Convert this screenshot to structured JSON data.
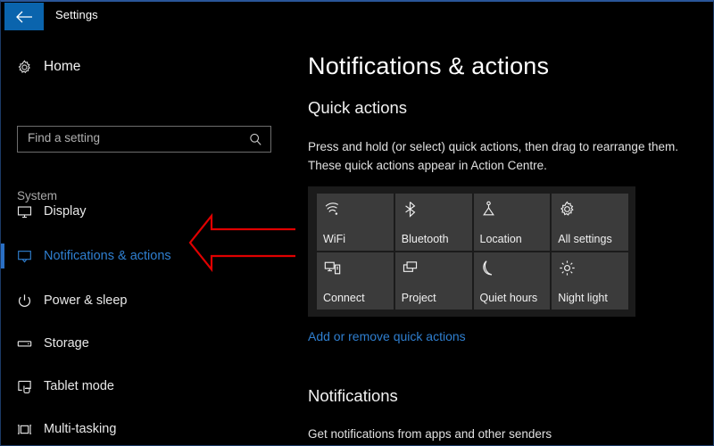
{
  "window": {
    "title": "Settings",
    "back_icon": "back-arrow-icon",
    "accent_color": "#0a64ad",
    "background_color": "#000000"
  },
  "sidebar": {
    "home": {
      "label": "Home",
      "icon": "gear-icon"
    },
    "search": {
      "value": "",
      "placeholder": "Find a setting",
      "icon": "search-icon"
    },
    "section_header": "System",
    "items": [
      {
        "label": "Display",
        "icon": "monitor-icon",
        "selected": false
      },
      {
        "label": "Notifications & actions",
        "icon": "notification-icon",
        "selected": true
      },
      {
        "label": "Power & sleep",
        "icon": "power-icon",
        "selected": false
      },
      {
        "label": "Storage",
        "icon": "drive-icon",
        "selected": false
      },
      {
        "label": "Tablet mode",
        "icon": "tablet-hand-icon",
        "selected": false
      },
      {
        "label": "Multi-tasking",
        "icon": "multitasking-icon",
        "selected": false
      }
    ],
    "selected_accent_color": "#2a6fc4",
    "selected_text_color": "#2f7fd0"
  },
  "annotation": {
    "name": "red-arrow-pointing-to-notifications-and-actions",
    "color": "#e00000"
  },
  "main": {
    "page_title": "Notifications & actions",
    "quick_actions": {
      "heading": "Quick actions",
      "description": "Press and hold (or select) quick actions, then drag to rearrange them. These quick actions appear in Action Centre.",
      "tiles": [
        {
          "label": "WiFi",
          "icon": "wifi-icon"
        },
        {
          "label": "Bluetooth",
          "icon": "bluetooth-icon"
        },
        {
          "label": "Location",
          "icon": "location-icon"
        },
        {
          "label": "All settings",
          "icon": "gear-icon"
        },
        {
          "label": "Connect",
          "icon": "connect-icon"
        },
        {
          "label": "Project",
          "icon": "project-icon"
        },
        {
          "label": "Quiet hours",
          "icon": "moon-icon"
        },
        {
          "label": "Night light",
          "icon": "sun-icon"
        }
      ],
      "link_label": "Add or remove quick actions",
      "link_color": "#2f7fd0"
    },
    "notifications": {
      "heading": "Notifications",
      "description": "Get notifications from apps and other senders"
    }
  }
}
